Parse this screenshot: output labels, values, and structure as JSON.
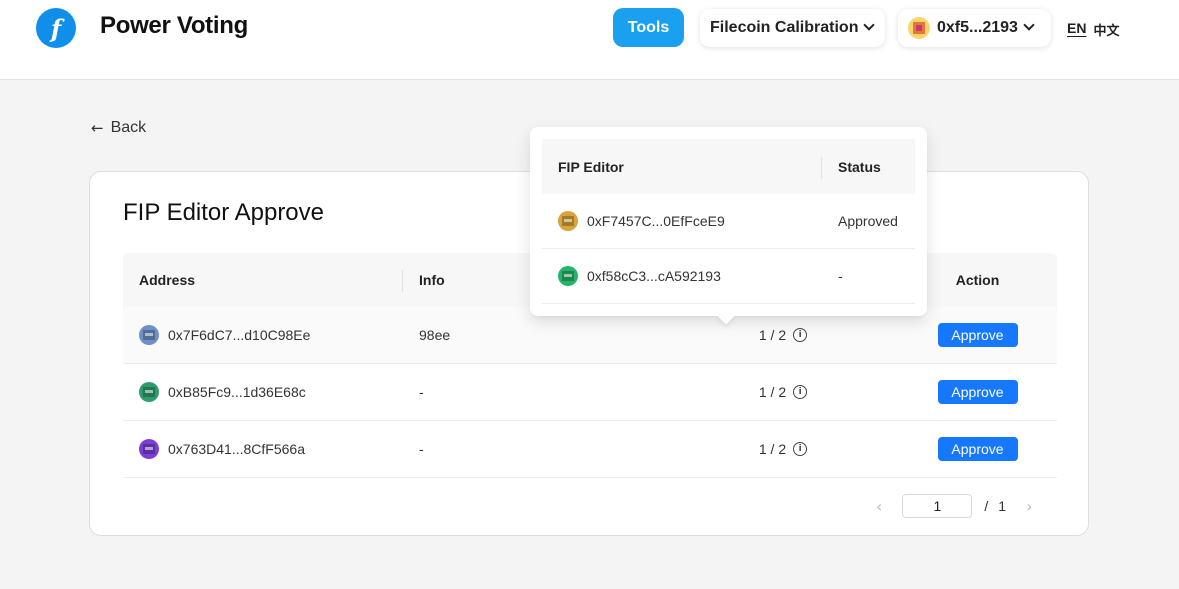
{
  "header": {
    "logo_glyph": "f",
    "app_title": "Power Voting",
    "tools_label": "Tools",
    "network": "Filecoin Calibration",
    "wallet": "0xf5...2193",
    "lang_en": "EN",
    "lang_zh": "中文"
  },
  "back_label": "Back",
  "card": {
    "title": "FIP Editor Approve",
    "columns": {
      "address": "Address",
      "info": "Info",
      "action": "Action"
    },
    "rows": [
      {
        "address": "0x7F6dC7...d10C98Ee",
        "info": "98ee",
        "progress": "1 / 2",
        "action": "Approve",
        "avatar_color": "#6f8fc7"
      },
      {
        "address": "0xB85Fc9...1d36E68c",
        "info": "-",
        "progress": "1 / 2",
        "action": "Approve",
        "avatar_color": "#2f9b6b"
      },
      {
        "address": "0x763D41...8CfF566a",
        "info": "-",
        "progress": "1 / 2",
        "action": "Approve",
        "avatar_color": "#7b3fd6"
      }
    ],
    "pagination": {
      "current": "1",
      "separator": "/",
      "total": "1"
    }
  },
  "popover": {
    "columns": {
      "editor": "FIP Editor",
      "status": "Status"
    },
    "rows": [
      {
        "editor": "0xF7457C...0EfFceE9",
        "status": "Approved",
        "avatar_color": "#d9a43a"
      },
      {
        "editor": "0xf58cC3...cA592193",
        "status": "-",
        "avatar_color": "#27b36a"
      }
    ]
  },
  "colors": {
    "primary": "#1677ff",
    "tools_accent": "#1ba0ef",
    "logo": "#0f8eea"
  }
}
